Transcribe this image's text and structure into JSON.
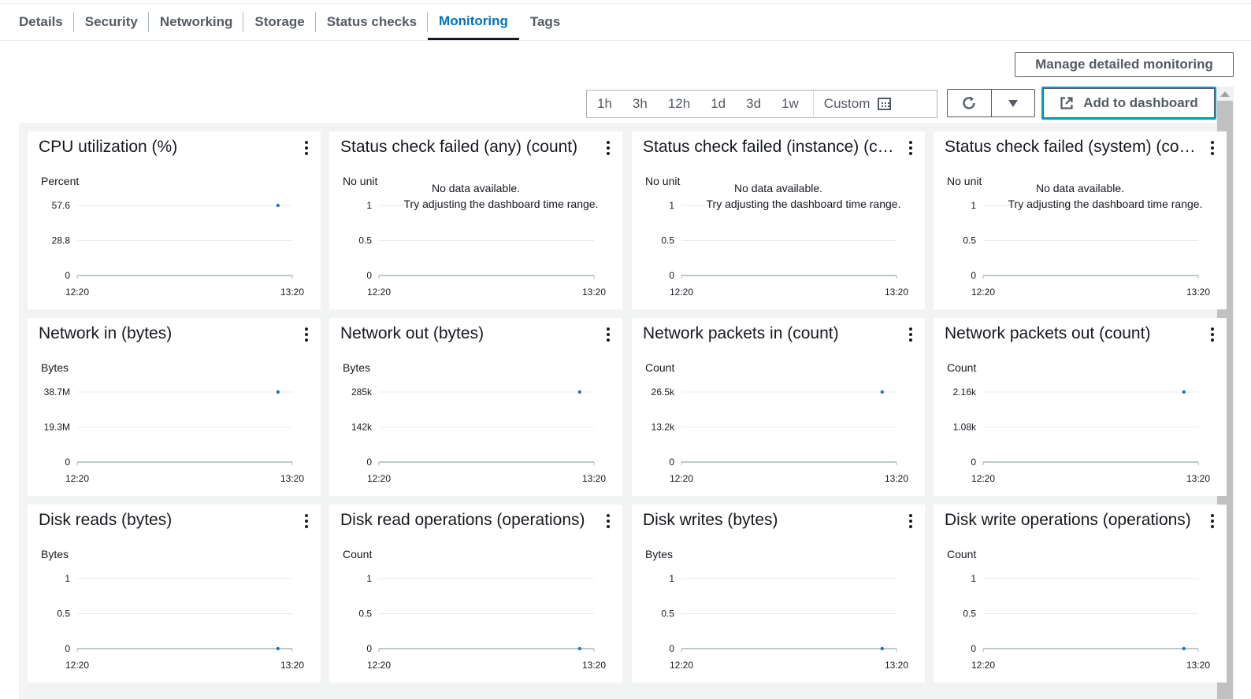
{
  "tabs": [
    {
      "label": "Details",
      "active": false
    },
    {
      "label": "Security",
      "active": false
    },
    {
      "label": "Networking",
      "active": false
    },
    {
      "label": "Storage",
      "active": false
    },
    {
      "label": "Status checks",
      "active": false
    },
    {
      "label": "Monitoring",
      "active": true
    },
    {
      "label": "Tags",
      "active": false
    }
  ],
  "toolbar": {
    "manage_label": "Manage detailed monitoring",
    "time_ranges": [
      "1h",
      "3h",
      "12h",
      "1d",
      "3d",
      "1w"
    ],
    "custom_label": "Custom",
    "add_dashboard_label": "Add to dashboard"
  },
  "no_data": {
    "line1": "No data available.",
    "line2": "Try adjusting the dashboard time range."
  },
  "colors": {
    "series": "#1f77b4",
    "accent": "#0073bb"
  },
  "chart_data": [
    {
      "type": "line",
      "title": "CPU utilization (%)",
      "ylabel": "Percent",
      "yticks": [
        "0",
        "28.8",
        "57.6"
      ],
      "xticks": [
        "12:20",
        "13:20"
      ],
      "has_data": true,
      "x": [
        "13:16"
      ],
      "values": [
        57.6
      ]
    },
    {
      "type": "line",
      "title": "Status check failed (any) (count)",
      "ylabel": "No unit",
      "yticks": [
        "0",
        "0.5",
        "1"
      ],
      "xticks": [
        "12:20",
        "13:20"
      ],
      "has_data": false,
      "x": [],
      "values": []
    },
    {
      "type": "line",
      "title": "Status check failed (instance) (count)",
      "ylabel": "No unit",
      "yticks": [
        "0",
        "0.5",
        "1"
      ],
      "xticks": [
        "12:20",
        "13:20"
      ],
      "has_data": false,
      "x": [],
      "values": []
    },
    {
      "type": "line",
      "title": "Status check failed (system) (count)",
      "ylabel": "No unit",
      "yticks": [
        "0",
        "0.5",
        "1"
      ],
      "xticks": [
        "12:20",
        "13:20"
      ],
      "has_data": false,
      "x": [],
      "values": []
    },
    {
      "type": "line",
      "title": "Network in (bytes)",
      "ylabel": "Bytes",
      "yticks": [
        "0",
        "19.3M",
        "38.7M"
      ],
      "xticks": [
        "12:20",
        "13:20"
      ],
      "has_data": true,
      "x": [
        "13:16"
      ],
      "values": [
        38.7
      ]
    },
    {
      "type": "line",
      "title": "Network out (bytes)",
      "ylabel": "Bytes",
      "yticks": [
        "0",
        "142k",
        "285k"
      ],
      "xticks": [
        "12:20",
        "13:20"
      ],
      "has_data": true,
      "x": [
        "13:16"
      ],
      "values": [
        285
      ]
    },
    {
      "type": "line",
      "title": "Network packets in (count)",
      "ylabel": "Count",
      "yticks": [
        "0",
        "13.2k",
        "26.5k"
      ],
      "xticks": [
        "12:20",
        "13:20"
      ],
      "has_data": true,
      "x": [
        "13:16"
      ],
      "values": [
        26.5
      ]
    },
    {
      "type": "line",
      "title": "Network packets out (count)",
      "ylabel": "Count",
      "yticks": [
        "0",
        "1.08k",
        "2.16k"
      ],
      "xticks": [
        "12:20",
        "13:20"
      ],
      "has_data": true,
      "x": [
        "13:16"
      ],
      "values": [
        2.16
      ]
    },
    {
      "type": "line",
      "title": "Disk reads (bytes)",
      "ylabel": "Bytes",
      "yticks": [
        "0",
        "0.5",
        "1"
      ],
      "xticks": [
        "12:20",
        "13:20"
      ],
      "has_data": true,
      "x": [
        "13:16"
      ],
      "values": [
        0
      ]
    },
    {
      "type": "line",
      "title": "Disk read operations (operations)",
      "ylabel": "Count",
      "yticks": [
        "0",
        "0.5",
        "1"
      ],
      "xticks": [
        "12:20",
        "13:20"
      ],
      "has_data": true,
      "x": [
        "13:16"
      ],
      "values": [
        0
      ]
    },
    {
      "type": "line",
      "title": "Disk writes (bytes)",
      "ylabel": "Bytes",
      "yticks": [
        "0",
        "0.5",
        "1"
      ],
      "xticks": [
        "12:20",
        "13:20"
      ],
      "has_data": true,
      "x": [
        "13:16"
      ],
      "values": [
        0
      ]
    },
    {
      "type": "line",
      "title": "Disk write operations (operations)",
      "ylabel": "Count",
      "yticks": [
        "0",
        "0.5",
        "1"
      ],
      "xticks": [
        "12:20",
        "13:20"
      ],
      "has_data": true,
      "x": [
        "13:16"
      ],
      "values": [
        0
      ]
    }
  ]
}
